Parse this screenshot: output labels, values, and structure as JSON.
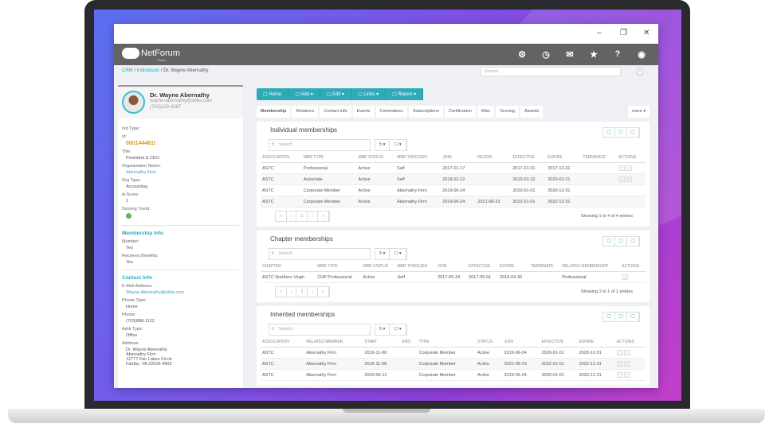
{
  "window": {
    "minimize": "–",
    "maximize": "❐",
    "close": "✕"
  },
  "header": {
    "brand": "NetForum",
    "brand_sub": "Cloud",
    "icons": [
      "gear-icon",
      "clock-icon",
      "mail-icon",
      "star-icon",
      "help-icon",
      "user-icon"
    ],
    "icon_glyphs": [
      "⚙",
      "◷",
      "✉",
      "★",
      "?",
      "◉"
    ]
  },
  "breadcrumb": [
    "CRM",
    "Individuals",
    "Dr. Wayne Abernathy"
  ],
  "global_search": {
    "placeholder": "Search"
  },
  "profile": {
    "name": "Dr. Wayne Abernathy",
    "email": "wayne-abernathy@abila.com",
    "phone": "(703)123-4567"
  },
  "fields": [
    {
      "label": "Ind Type:",
      "value": ""
    },
    {
      "label": "Id:",
      "value": "000144461I",
      "kind": "id"
    },
    {
      "label": "Title:",
      "value": "President & CEO"
    },
    {
      "label": "Organization Name:",
      "value": "Abernathy Firm",
      "kind": "link"
    },
    {
      "label": "Org Type:",
      "value": "Accounting"
    },
    {
      "label": "A-Score:",
      "value": "1"
    },
    {
      "label": "Scoring Trend:",
      "value": "",
      "kind": "trend"
    }
  ],
  "membership_info": {
    "title": "Membership Info",
    "fields": [
      {
        "label": "Member:",
        "value": "Yes"
      },
      {
        "label": "Receives Benefits:",
        "value": "Yes"
      }
    ]
  },
  "contact_info": {
    "title": "Contact Info",
    "fields": [
      {
        "label": "E-Mail Address:",
        "value": "Wayne-Abernathy@abila.com",
        "kind": "link"
      },
      {
        "label": "Phone Type:",
        "value": "Home"
      },
      {
        "label": "Phone:",
        "value": "(703)888-1122"
      },
      {
        "label": "Addr Type:",
        "value": "Office"
      },
      {
        "label": "Address:",
        "value": "Dr. Wayne Abernathy\nAbernathy Firm\n12777 Fair Lakes Circle\nFairfax, VA 22033-4903"
      }
    ]
  },
  "toolbar": [
    "Home",
    "Add ▾",
    "Edit ▾",
    "Links ▾",
    "Report ▾"
  ],
  "tabs": [
    "Membership",
    "Relations",
    "Contact info",
    "Events",
    "Committees",
    "Subscriptions",
    "Certification",
    "Misc",
    "Scoring",
    "Awards"
  ],
  "more_tab": "more ▾",
  "panels": [
    {
      "title": "Individual memberships",
      "search": "Search",
      "page_size": "5 ▾",
      "columns_btn": "☐ ▾",
      "headers": [
        "ASSOCIATION",
        "MBR TYPE",
        "MBR STATUS",
        "MBR THROUGH",
        "JOIN",
        "REJOIN",
        "EFFECTIVE",
        "EXPIRE",
        "TERMINATE",
        "ACTIONS"
      ],
      "rows": [
        [
          "ASTC",
          "Professional",
          "Active",
          "Self",
          "2017-01-17",
          "",
          "2017-01-01",
          "2017-12-31",
          "",
          "gr"
        ],
        [
          "ASTC",
          "Associate",
          "Active",
          "Self",
          "2018-02-22",
          "",
          "2019-02-22",
          "2020-02-21",
          "",
          "gr"
        ],
        [
          "ASTC",
          "Corporate Member",
          "Active",
          "Abernathy Firm",
          "2019-06-24",
          "",
          "2020-01-01",
          "2020-12-31",
          "",
          ""
        ],
        [
          "ASTC",
          "Corporate Member",
          "Active",
          "Abernathy Firm",
          "2019-06-24",
          "2021-08-23",
          "2022-01-01",
          "2022-12-31",
          "",
          ""
        ]
      ],
      "pager": [
        "«",
        "‹",
        "1",
        "›",
        "»"
      ],
      "info": "Showing 1 to 4 of 4 entries"
    },
    {
      "title": "Chapter memberships",
      "search": "Search",
      "page_size": "5 ▾",
      "columns_btn": "☐ ▾",
      "headers": [
        "CHAPTER",
        "MBR TYPE",
        "MBR STATUS",
        "MBR THROUGH",
        "JOIN",
        "EFFECTIVE",
        "EXPIRE",
        "TERMINATE",
        "RELATED MEMBERSHIP",
        "ACTIONS"
      ],
      "rows": [
        [
          "ASTC Northern Virgin",
          "CHP Professional",
          "Active",
          "Self",
          "2017-05-24",
          "2017-05-01",
          "2018-04-30",
          "",
          "Professional",
          "g"
        ]
      ],
      "pager": [
        "«",
        "‹",
        "1",
        "›",
        "»"
      ],
      "info": "Showing 1 to 1 of 1 entries"
    },
    {
      "title": "Inherited memberships",
      "search": "Search",
      "page_size": "5 ▾",
      "columns_btn": "☐ ▾",
      "headers": [
        "ASSOCIATION",
        "RELATED MEMBER",
        "START",
        "END",
        "TYPE",
        "STATUS",
        "JOIN",
        "EFFECTIVE",
        "EXPIRE",
        "ACTIONS"
      ],
      "rows": [
        [
          "ASTC",
          "Abernathy Firm",
          "2016-11-08",
          "",
          "Corporate Member",
          "Active",
          "2019-06-24",
          "2020-01-01",
          "2020-12-31",
          "br"
        ],
        [
          "ASTC",
          "Abernathy Firm",
          "2016-11-08",
          "",
          "Corporate Member",
          "Active",
          "2021-08-23",
          "2022-01-01",
          "2022-12-31",
          "br"
        ],
        [
          "ASTC",
          "Abernathy Firm",
          "2020-06-12",
          "",
          "Corporate Member",
          "Active",
          "2019-06-24",
          "2020-01-01",
          "2020-12-31",
          "br"
        ]
      ]
    }
  ]
}
